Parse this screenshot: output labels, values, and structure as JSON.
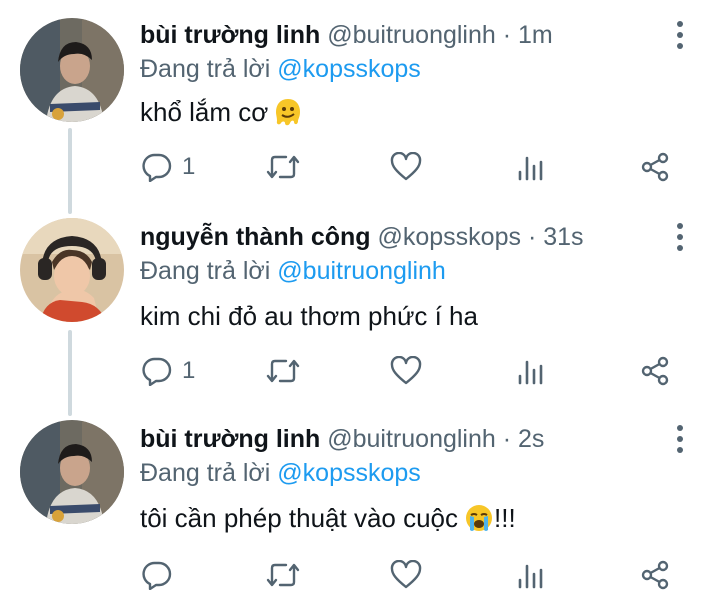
{
  "tweets": [
    {
      "name": "bùi trường linh",
      "handle": "@buitruonglinh",
      "time": "1m",
      "reply_prefix": "Đang trả lời",
      "reply_to": "@kopsskops",
      "text": "khổ lắm cơ",
      "emoji": "melting-face-emoji",
      "reply_count": "1",
      "avatar_icon": "avatar-photo"
    },
    {
      "name": "nguyễn thành công",
      "handle": "@kopsskops",
      "time": "31s",
      "reply_prefix": "Đang trả lời",
      "reply_to": "@buitruonglinh",
      "text": "kim chi đỏ au thơm phức í ha",
      "reply_count": "1",
      "avatar_icon": "avatar-photo"
    },
    {
      "name": "bùi trường linh",
      "handle": "@buitruonglinh",
      "time": "2s",
      "reply_prefix": "Đang trả lời",
      "reply_to": "@kopsskops",
      "text": "tôi cần phép thuật vào cuộc",
      "text_suffix": "!!!",
      "emoji": "loudly-crying-face-emoji",
      "reply_count": "",
      "avatar_icon": "avatar-photo"
    }
  ],
  "separator": "·",
  "colors": {
    "link": "#1d9bf0",
    "secondary": "#536471",
    "thread_line": "#cfd9de"
  },
  "icons": [
    "reply-icon",
    "retweet-icon",
    "like-icon",
    "analytics-icon",
    "share-icon",
    "more-vertical-icon"
  ]
}
